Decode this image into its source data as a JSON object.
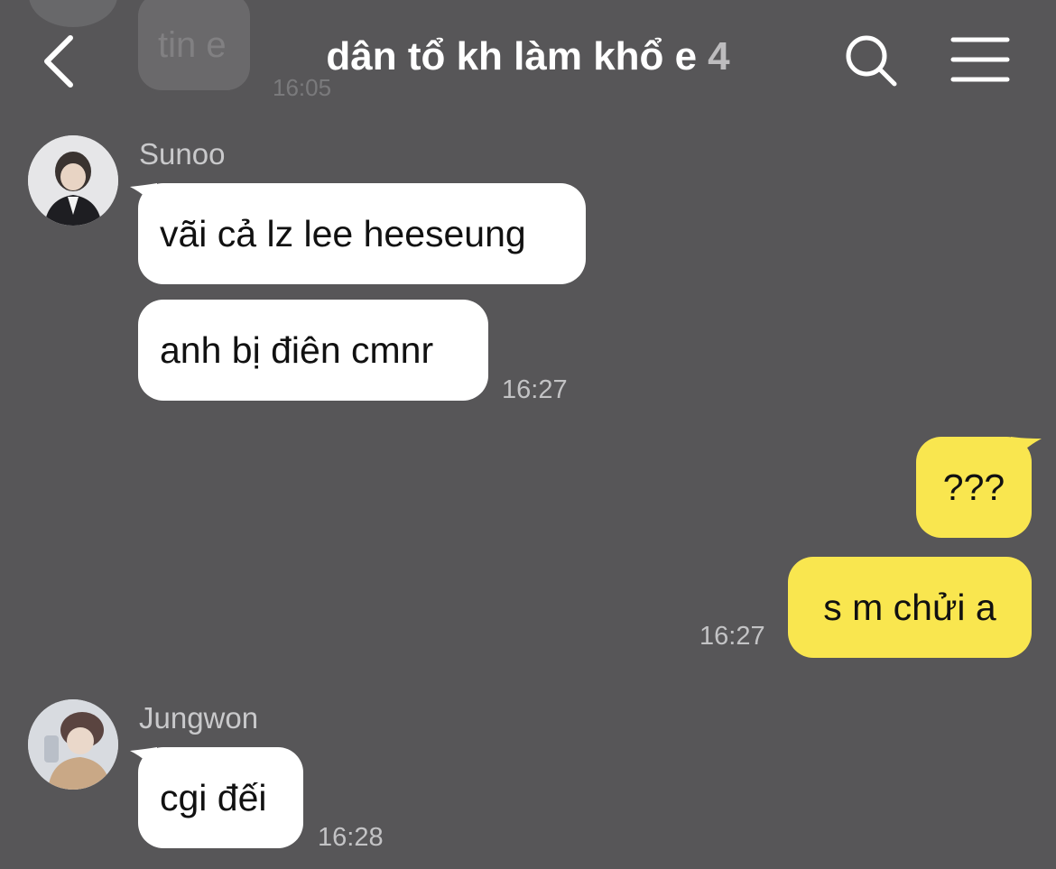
{
  "background_color": "#575658",
  "header": {
    "title": "dân tổ kh làm khổ e",
    "member_count": "4",
    "back_icon": "chevron-left-icon",
    "search_icon": "search-icon",
    "menu_icon": "hamburger-menu-icon"
  },
  "previous_message": {
    "text": "tin e",
    "time": "16:05"
  },
  "messages": [
    {
      "sender": "Sunoo",
      "bubbles": [
        "vãi cả lz lee heeseung",
        "anh bị điên cmnr"
      ],
      "time": "16:27",
      "bubble_color": "#ffffff"
    },
    {
      "sender": "me",
      "bubbles": [
        "???",
        "s m chửi a"
      ],
      "time": "16:27",
      "bubble_color": "#f9e64f"
    },
    {
      "sender": "Jungwon",
      "bubbles": [
        "cgi đếi"
      ],
      "time": "16:28",
      "bubble_color": "#ffffff"
    }
  ]
}
